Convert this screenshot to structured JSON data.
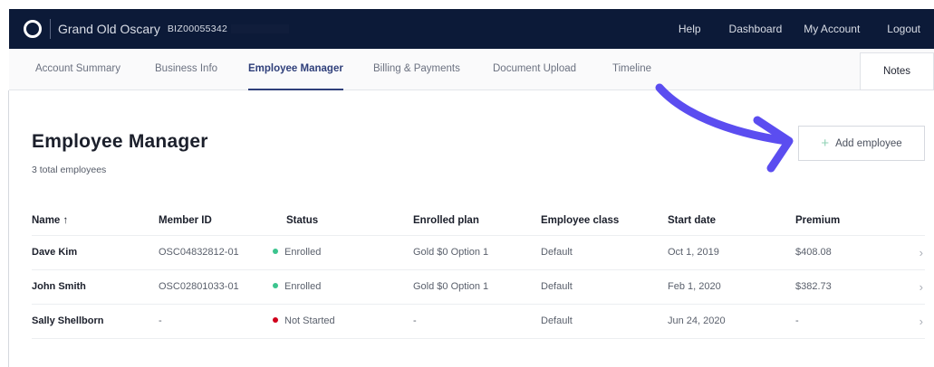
{
  "topbar": {
    "brand": "Grand Old Oscary",
    "biz_id": "BIZ00055342",
    "nav": {
      "help": "Help",
      "dashboard": "Dashboard",
      "account": "My Account",
      "logout": "Logout"
    }
  },
  "tabs": [
    {
      "label": "Account Summary",
      "active": false
    },
    {
      "label": "Business Info",
      "active": false
    },
    {
      "label": "Employee Manager",
      "active": true
    },
    {
      "label": "Billing & Payments",
      "active": false
    },
    {
      "label": "Document Upload",
      "active": false
    },
    {
      "label": "Timeline",
      "active": false
    }
  ],
  "notes_label": "Notes",
  "page": {
    "title": "Employee Manager",
    "count_text": "3 total employees",
    "add_button": "Add employee",
    "add_icon": "+"
  },
  "table": {
    "headers": [
      "Name ↑",
      "Member ID",
      "Status",
      "Enrolled plan",
      "Employee class",
      "Start date",
      "Premium"
    ],
    "rows": [
      {
        "name": "Dave Kim",
        "member_id": "OSC04832812-01",
        "status": "Enrolled",
        "status_color": "#3cc48e",
        "plan": "Gold $0 Option 1",
        "class": "Default",
        "start": "Oct 1, 2019",
        "premium": "$408.08"
      },
      {
        "name": "John Smith",
        "member_id": "OSC02801033-01",
        "status": "Enrolled",
        "status_color": "#3cc48e",
        "plan": "Gold $0 Option 1",
        "class": "Default",
        "start": "Feb 1, 2020",
        "premium": "$382.73"
      },
      {
        "name": "Sally Shellborn",
        "member_id": "-",
        "status": "Not Started",
        "status_color": "#d0021b",
        "plan": "-",
        "class": "Default",
        "start": "Jun 24, 2020",
        "premium": "-"
      }
    ]
  },
  "colors": {
    "topbar_bg": "#0c1a38",
    "accent": "#2f3f7a",
    "arrow": "#5b4df0",
    "enrolled": "#3cc48e",
    "not_started": "#d0021b"
  },
  "icons": {
    "logo": "brand-logo-icon",
    "sort": "arrow-up-icon",
    "row_chevron": "chevron-right-icon",
    "annotation": "curved-arrow-icon"
  }
}
